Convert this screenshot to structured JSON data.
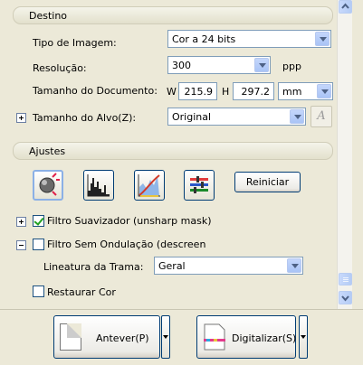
{
  "destino": {
    "header": "Destino",
    "tipo_label": "Tipo de Imagem:",
    "tipo_value": "Cor a 24 bits",
    "resolucao_label": "Resolução:",
    "resolucao_value": "300",
    "resolucao_unit": "ppp",
    "tamanho_doc_label": "Tamanho do Documento:",
    "w_label": "W",
    "w_value": "215.9",
    "h_label": "H",
    "h_value": "297.2",
    "unit_value": "mm",
    "tamanho_alvo_label": "Tamanho do Alvo(Z):",
    "tamanho_alvo_value": "Original"
  },
  "ajustes": {
    "header": "Ajustes",
    "reiniciar": "Reiniciar",
    "filtro_suavizador": "Filtro Suavizador (unsharp mask)",
    "filtro_sem_ondulacao": "Filtro Sem Ondulação (descreen",
    "lineatura_label": "Lineatura da Trama:",
    "lineatura_value": "Geral",
    "restaurar_cor": "Restaurar Cor"
  },
  "actions": {
    "antever": "Antever(P)",
    "digitalizar": "Digitalizar(S)"
  },
  "icons": [
    "auto-exposure-icon",
    "histogram-icon",
    "tone-curve-icon",
    "color-balance-icon",
    "document-icon",
    "scanner-icon"
  ]
}
